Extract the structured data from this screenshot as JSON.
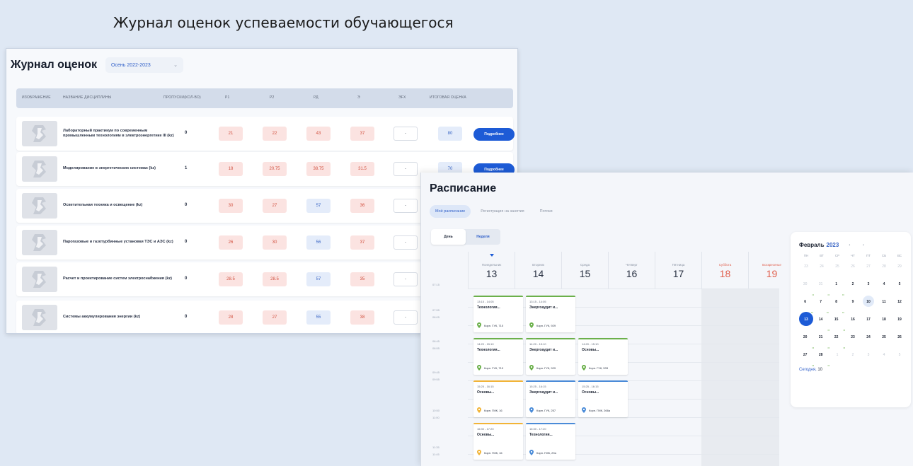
{
  "slide_title": "Журнал оценок успеваемости обучающегося",
  "journal": {
    "title": "Журнал оценок",
    "semester": "Осень 2022-2023",
    "columns": [
      "ИЗОБРАЖЕНИЕ",
      "НАЗВАНИЕ ДИСЦИПЛИНЫ",
      "ПРОПУСКИ(КОЛ-ВО)",
      "Р1",
      "Р2",
      "РД",
      "Э",
      "ЭFX",
      "ИТОГОВАЯ ОЦЕНКА"
    ],
    "more_label": "Подробнее",
    "rows": [
      {
        "name": "Лабораторный практикум по современным промышленным технологиям в электроэнергетике III (kz)",
        "absences": "0",
        "r1": "21",
        "r2": "22",
        "rd": "43",
        "e": "37",
        "efx": "-",
        "final": "80",
        "rd_color": "red",
        "final_color": "blue",
        "has_button": true
      },
      {
        "name": "Моделирование в энергетических системах (kz)",
        "absences": "1",
        "r1": "18",
        "r2": "20.75",
        "rd": "38.75",
        "e": "31.5",
        "efx": "-",
        "final": "70",
        "rd_color": "red",
        "final_color": "blue",
        "has_button": true
      },
      {
        "name": "Осветительная техника и освещение (kz)",
        "absences": "0",
        "r1": "30",
        "r2": "27",
        "rd": "57",
        "e": "36",
        "efx": "-",
        "rd_color": "blue"
      },
      {
        "name": "Парогазовые и газотурбинные установки ТЭС и АЭС (kz)",
        "absences": "0",
        "r1": "26",
        "r2": "30",
        "rd": "56",
        "e": "37",
        "efx": "-",
        "rd_color": "blue"
      },
      {
        "name": "Расчет и проектирование систем электроснабжения (kz)",
        "absences": "0",
        "r1": "28.5",
        "r2": "28.5",
        "rd": "57",
        "e": "35",
        "efx": "-",
        "rd_color": "blue"
      },
      {
        "name": "Системы аккумулирования энергии (kz)",
        "absences": "0",
        "r1": "28",
        "r2": "27",
        "rd": "55",
        "e": "38",
        "efx": "-",
        "rd_color": "blue"
      }
    ]
  },
  "schedule": {
    "title": "Расписание",
    "tabs": [
      "Моё расписание",
      "Регистрация на занятия",
      "Потоки"
    ],
    "view_day": "День",
    "view_week": "Неделя",
    "days": [
      {
        "name": "Понедельник",
        "date": "13"
      },
      {
        "name": "Вторник",
        "date": "14"
      },
      {
        "name": "Среда",
        "date": "15"
      },
      {
        "name": "Четверг",
        "date": "16"
      },
      {
        "name": "Пятница",
        "date": "17"
      },
      {
        "name": "Суббота",
        "date": "18"
      },
      {
        "name": "Воскресенье",
        "date": "19"
      }
    ],
    "times": [
      "07:15",
      "07:55",
      "08:05",
      "08:45",
      "08:55",
      "09:45",
      "09:55",
      "10:50",
      "11:00",
      "11:35",
      "11:45"
    ],
    "events": [
      {
        "time": "13:15 - 14:05",
        "name": "Технология...",
        "loc": "Корп. ГУК, 710",
        "color": "green"
      },
      {
        "time": "13:15 - 14:05",
        "name": "Энергоаудит и...",
        "loc": "Корп. ГУК, 929",
        "color": "green"
      },
      {
        "time": "14:20 - 15:10",
        "name": "Технология...",
        "loc": "Корп. ГУК, 710",
        "color": "green"
      },
      {
        "time": "14:20 - 15:10",
        "name": "Энергоаудит и...",
        "loc": "Корп. ГУК, 929",
        "color": "green"
      },
      {
        "time": "14:20 - 15:10",
        "name": "Основы...",
        "loc": "Корп. ГУК, 533",
        "color": "green"
      },
      {
        "time": "15:25 - 16:15",
        "name": "Основы...",
        "loc": "Корп. ГМК, 16",
        "color": "yellow"
      },
      {
        "time": "15:25 - 16:15",
        "name": "Энергоаудит и...",
        "loc": "Корп. ГУК, 257",
        "color": "blue"
      },
      {
        "time": "15:25 - 16:15",
        "name": "Основы...",
        "loc": "Корп. ГМК, 266a",
        "color": "blue"
      },
      {
        "time": "16:30 - 17:20",
        "name": "Основы...",
        "loc": "Корп. ГМК, 16",
        "color": "yellow"
      },
      {
        "time": "16:30 - 17:20",
        "name": "Технология...",
        "loc": "Корп. ГМК, 29a",
        "color": "blue"
      }
    ]
  },
  "mini_calendar": {
    "month": "Февраль",
    "year": "2023",
    "nav": "‹ ›",
    "dow": [
      "ПН",
      "ВТ",
      "СР",
      "ЧТ",
      "ПТ",
      "СБ",
      "ВС"
    ],
    "weeks": [
      [
        "23",
        "24",
        "25",
        "26",
        "27",
        "28",
        "29"
      ],
      [
        "30",
        "31",
        "1",
        "2",
        "3",
        "4",
        "5"
      ],
      [
        "6",
        "7",
        "8",
        "9",
        "10",
        "11",
        "12"
      ],
      [
        "13",
        "14",
        "15",
        "16",
        "17",
        "18",
        "19"
      ],
      [
        "20",
        "21",
        "22",
        "23",
        "24",
        "25",
        "26"
      ],
      [
        "27",
        "28",
        "1",
        "2",
        "3",
        "4",
        "5"
      ]
    ],
    "today_label": "Сегодня,",
    "today_value": "10"
  }
}
